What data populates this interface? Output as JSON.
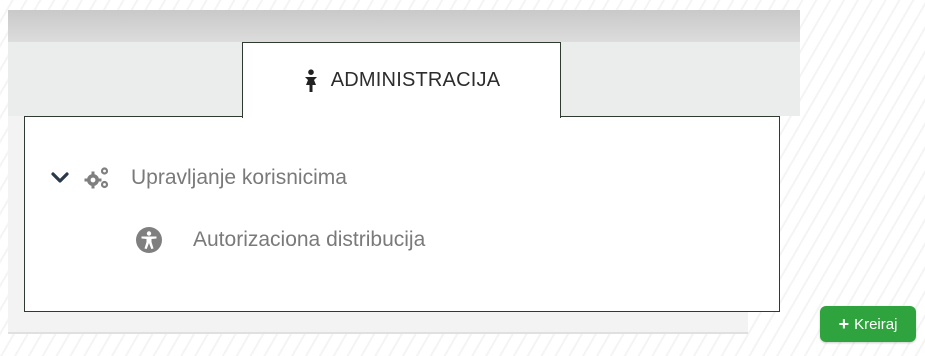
{
  "tab": {
    "label": "ADMINISTRACIJA",
    "icon": "person-icon"
  },
  "tree": {
    "parent": {
      "label": "Upravljanje korisnicima",
      "icon": "gears-icon",
      "expanded": true
    },
    "children": [
      {
        "label": "Autorizaciona distribucija",
        "icon": "universal-access-icon"
      }
    ]
  },
  "create_button": {
    "label": "Kreiraj",
    "icon": "plus-icon",
    "color": "#2fa33e"
  }
}
